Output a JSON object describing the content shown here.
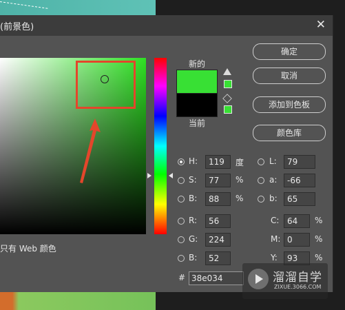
{
  "dialog": {
    "title": "(前景色)",
    "close": "✕"
  },
  "swatches": {
    "new_label": "新的",
    "current_label": "当前",
    "new_color": "#38e034",
    "current_color": "#000000"
  },
  "buttons": {
    "ok": "确定",
    "cancel": "取消",
    "add_swatch": "添加到色板",
    "libraries": "颜色库"
  },
  "web_only_label": "只有 Web 颜色",
  "hsb": {
    "h_label": "H:",
    "h_value": "119",
    "h_unit": "度",
    "s_label": "S:",
    "s_value": "77",
    "s_unit": "%",
    "b_label": "B:",
    "b_value": "88",
    "b_unit": "%"
  },
  "lab": {
    "l_label": "L:",
    "l_value": "79",
    "a_label": "a:",
    "a_value": "-66",
    "b_label": "b:",
    "b_value": "65"
  },
  "rgb": {
    "r_label": "R:",
    "r_value": "56",
    "g_label": "G:",
    "g_value": "224",
    "b_label": "B:",
    "b_value": "52"
  },
  "cmyk": {
    "c_label": "C:",
    "c_value": "64",
    "c_unit": "%",
    "m_label": "M:",
    "m_value": "0",
    "m_unit": "%",
    "y_label": "Y:",
    "y_value": "93",
    "y_unit": "%"
  },
  "hex": {
    "label": "#",
    "value": "38e034"
  },
  "watermark": {
    "brand": "溜溜自学",
    "url": "ZIXUE.3066.COM"
  },
  "colors": {
    "panel": "#535353",
    "annotation": "#e4462b",
    "field_hue": "#2ee022"
  }
}
